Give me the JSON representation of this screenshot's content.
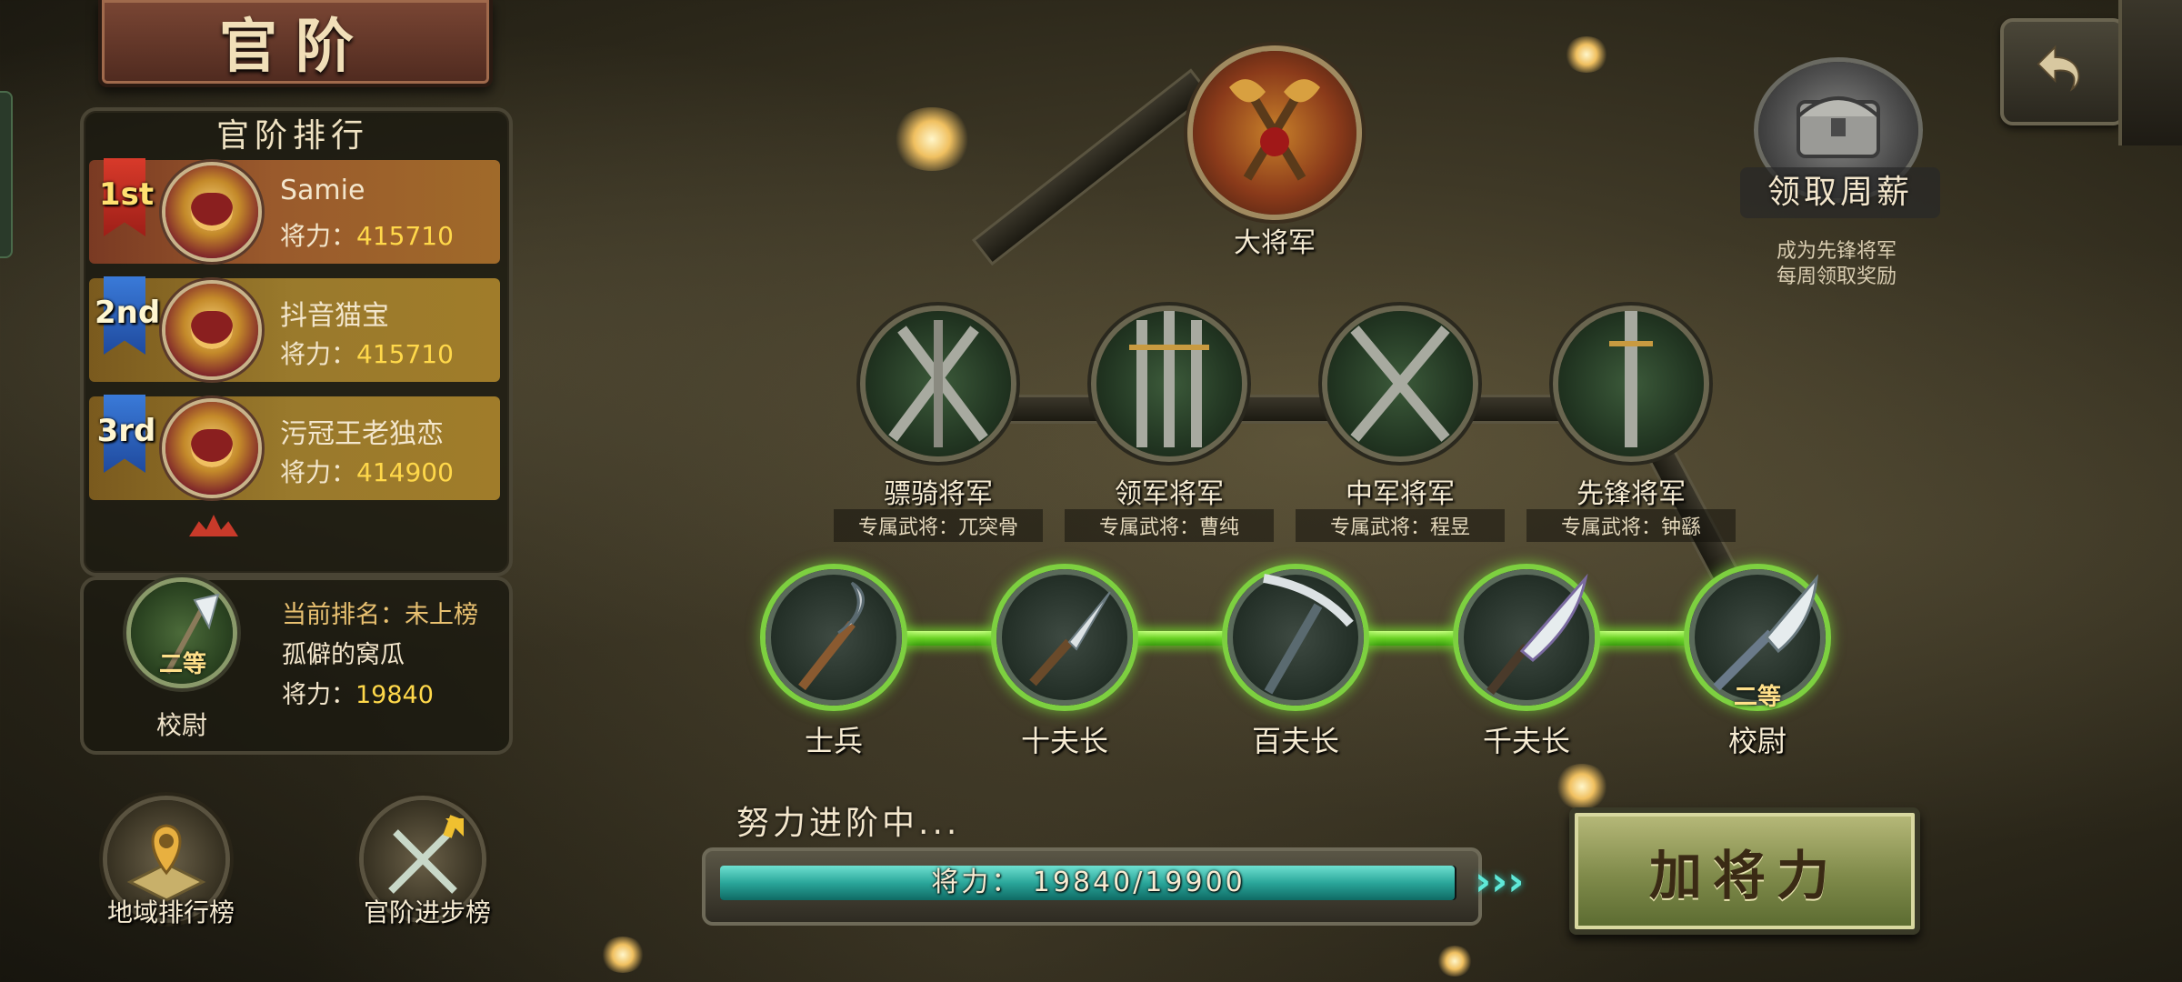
{
  "title": "官阶",
  "ranking": {
    "title": "官阶排行",
    "entries": [
      {
        "rank": "1st",
        "name": "Samie",
        "power_label": "将力：",
        "power": "415710"
      },
      {
        "rank": "2nd",
        "name": "抖音猫宝",
        "power_label": "将力：",
        "power": "415710"
      },
      {
        "rank": "3rd",
        "name": "污冠王老独恋",
        "power_label": "将力：",
        "power": "414900"
      }
    ]
  },
  "me": {
    "badge_rank": "二等",
    "badge_title": "校尉",
    "current_rank_label": "当前排名：",
    "current_rank_value": "未上榜",
    "name": "孤僻的窝瓜",
    "power_label": "将力：",
    "power": "19840"
  },
  "bottom_buttons": {
    "region": "地域排行榜",
    "progress": "官阶进步榜"
  },
  "weekly": {
    "label": "领取周薪",
    "note_line1": "成为先锋将军",
    "note_line2": "每周领取奖励"
  },
  "tree": {
    "top": "大将军",
    "generals": [
      {
        "name": "骠骑将军",
        "sub": "专属武将：兀突骨"
      },
      {
        "name": "领军将军",
        "sub": "专属武将：曹纯"
      },
      {
        "name": "中军将军",
        "sub": "专属武将：程昱"
      },
      {
        "name": "先锋将军",
        "sub": "专属武将：钟繇"
      }
    ],
    "ranks": [
      {
        "name": "士兵"
      },
      {
        "name": "十夫长"
      },
      {
        "name": "百夫长"
      },
      {
        "name": "千夫长"
      },
      {
        "name": "校尉",
        "badge": "二等"
      }
    ]
  },
  "progress": {
    "title": "努力进阶中...",
    "label": "将力：",
    "current": 19840,
    "target": 19900,
    "text": "将力： 19840/19900"
  },
  "actions": {
    "add_power": "加将力"
  },
  "colors": {
    "accent_green": "#7dd040",
    "gold": "#ffd84a",
    "teal_fill": "#2aa69a"
  }
}
